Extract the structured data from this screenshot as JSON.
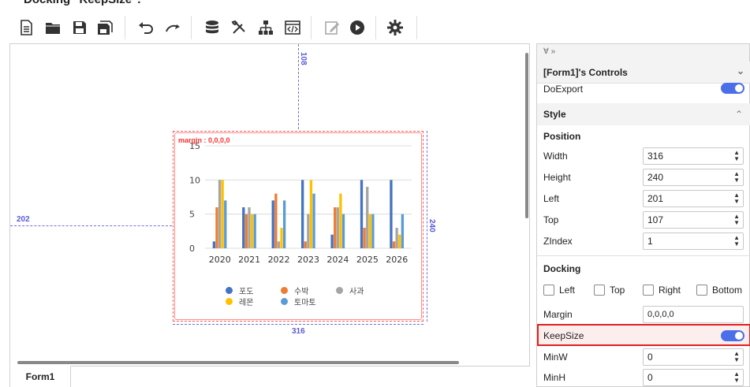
{
  "caption": "Docking \"KeepSize\".",
  "toolbar": {
    "icons": [
      "new-file-icon",
      "open-folder-icon",
      "save-icon",
      "save-all-icon",
      "undo-icon",
      "redo-icon",
      "database-icon",
      "tools-icon",
      "hierarchy-icon",
      "code-view-icon",
      "edit-icon",
      "run-icon",
      "settings-icon"
    ]
  },
  "designer": {
    "guide_top": "108",
    "guide_left": "202",
    "guide_height": "240",
    "guide_width": "316",
    "margin_label": "margin : 0,0,0,0"
  },
  "chart_data": {
    "type": "bar",
    "categories": [
      "2020",
      "2021",
      "2022",
      "2023",
      "2024",
      "2025",
      "2026"
    ],
    "ylim": [
      0,
      15
    ],
    "yticks": [
      "0",
      "5",
      "10",
      "15"
    ],
    "series": [
      {
        "name": "포도",
        "color": "#4472C4",
        "values": [
          1,
          6,
          7,
          10,
          2,
          10,
          10
        ]
      },
      {
        "name": "수박",
        "color": "#ED7D31",
        "values": [
          6,
          5,
          8,
          1,
          6,
          3,
          1
        ]
      },
      {
        "name": "사과",
        "color": "#A5A5A5",
        "values": [
          10,
          6,
          1,
          5,
          6,
          9,
          3
        ]
      },
      {
        "name": "레몬",
        "color": "#FFC000",
        "values": [
          10,
          5,
          3,
          10,
          8,
          5,
          2
        ]
      },
      {
        "name": "토마토",
        "color": "#5B9BD5",
        "values": [
          7,
          5,
          7,
          8,
          5,
          5,
          5
        ]
      }
    ],
    "legend_position": "bottom"
  },
  "tabs": [
    "Form1"
  ],
  "panel": {
    "pin_label": "Ɐ »",
    "header": "[Form1]'s Controls",
    "doexport_label": "DoExport",
    "style_label": "Style",
    "position_label": "Position",
    "width_label": "Width",
    "width_value": "316",
    "height_label": "Height",
    "height_value": "240",
    "left_label": "Left",
    "left_value": "201",
    "top_label": "Top",
    "top_value": "107",
    "zindex_label": "ZIndex",
    "zindex_value": "1",
    "docking_label": "Docking",
    "dock_left": "Left",
    "dock_top": "Top",
    "dock_right": "Right",
    "dock_bottom": "Bottom",
    "margin_label": "Margin",
    "margin_value": "0,0,0,0",
    "keepsize_label": "KeepSize",
    "minw_label": "MinW",
    "minw_value": "0",
    "minh_label": "MinH",
    "minh_value": "0"
  }
}
